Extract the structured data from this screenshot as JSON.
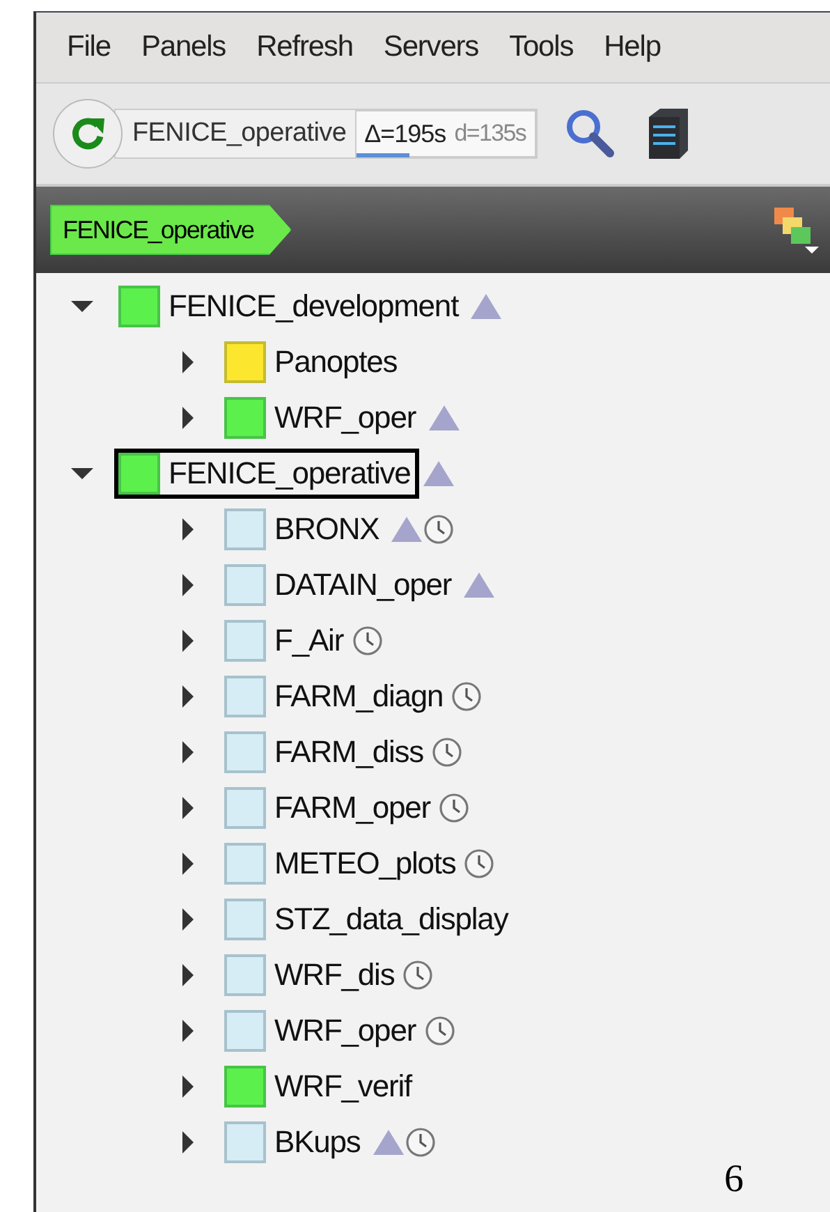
{
  "menu": [
    {
      "label": "File"
    },
    {
      "label": "Panels"
    },
    {
      "label": "Refresh"
    },
    {
      "label": "Servers"
    },
    {
      "label": "Tools"
    },
    {
      "label": "Help"
    }
  ],
  "toolbar": {
    "server": "FENICE_operative",
    "delta": "Δ=195s",
    "interval": "d=135s",
    "level": 0.3
  },
  "breadcrumb": {
    "label": "FENICE_operative"
  },
  "tree": [
    {
      "name": "FENICE_development",
      "color": "#5cf04c",
      "expanded": true,
      "selected": false,
      "zombie": true,
      "clock": false,
      "children": [
        {
          "name": "Panoptes",
          "color": "#fce62e",
          "expanded": false,
          "selected": false,
          "zombie": false,
          "clock": false
        },
        {
          "name": "WRF_oper",
          "color": "#5cf04c",
          "expanded": false,
          "selected": false,
          "zombie": true,
          "clock": false
        }
      ]
    },
    {
      "name": "FENICE_operative",
      "color": "#5cf04c",
      "expanded": true,
      "selected": true,
      "zombie": true,
      "clock": false,
      "children": [
        {
          "name": "BRONX",
          "color": "#d6edf5",
          "expanded": false,
          "selected": false,
          "zombie": true,
          "clock": true
        },
        {
          "name": "DATAIN_oper",
          "color": "#d6edf5",
          "expanded": false,
          "selected": false,
          "zombie": true,
          "clock": false
        },
        {
          "name": "F_Air",
          "color": "#d6edf5",
          "expanded": false,
          "selected": false,
          "zombie": false,
          "clock": true
        },
        {
          "name": "FARM_diagn",
          "color": "#d6edf5",
          "expanded": false,
          "selected": false,
          "zombie": false,
          "clock": true
        },
        {
          "name": "FARM_diss",
          "color": "#d6edf5",
          "expanded": false,
          "selected": false,
          "zombie": false,
          "clock": true
        },
        {
          "name": "FARM_oper",
          "color": "#d6edf5",
          "expanded": false,
          "selected": false,
          "zombie": false,
          "clock": true
        },
        {
          "name": "METEO_plots",
          "color": "#d6edf5",
          "expanded": false,
          "selected": false,
          "zombie": false,
          "clock": true
        },
        {
          "name": "STZ_data_display",
          "color": "#d6edf5",
          "expanded": false,
          "selected": false,
          "zombie": false,
          "clock": false
        },
        {
          "name": "WRF_dis",
          "color": "#d6edf5",
          "expanded": false,
          "selected": false,
          "zombie": false,
          "clock": true
        },
        {
          "name": "WRF_oper",
          "color": "#d6edf5",
          "expanded": false,
          "selected": false,
          "zombie": false,
          "clock": true
        },
        {
          "name": "WRF_verif",
          "color": "#5cf04c",
          "expanded": false,
          "selected": false,
          "zombie": false,
          "clock": false
        },
        {
          "name": "BKups",
          "color": "#d6edf5",
          "expanded": false,
          "selected": false,
          "zombie": true,
          "clock": true
        }
      ]
    }
  ],
  "page_number": "6"
}
